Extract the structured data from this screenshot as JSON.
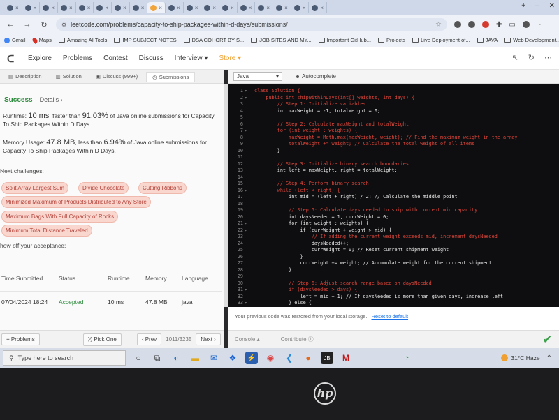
{
  "browser": {
    "url": "leetcode.com/problems/capacity-to-ship-packages-within-d-days/submissions/",
    "bookmarks": [
      {
        "label": "Gmail",
        "icon": "gmail-icon"
      },
      {
        "label": "Maps",
        "icon": "maps-pin-icon"
      },
      {
        "label": "Amazing AI Tools",
        "icon": "folder-icon"
      },
      {
        "label": "IMP SUBJECT NOTES",
        "icon": "folder-icon"
      },
      {
        "label": "DSA COHORT BY S...",
        "icon": "folder-icon"
      },
      {
        "label": "JOB SITES AND MY...",
        "icon": "folder-icon"
      },
      {
        "label": "Important GitHub...",
        "icon": "folder-icon"
      },
      {
        "label": "Projects",
        "icon": "folder-icon"
      },
      {
        "label": "Live Deployment of...",
        "icon": "folder-icon"
      },
      {
        "label": "JAVA",
        "icon": "folder-icon"
      },
      {
        "label": "Web Development...",
        "icon": "folder-icon"
      }
    ]
  },
  "nav": {
    "explore": "Explore",
    "problems": "Problems",
    "contest": "Contest",
    "discuss": "Discuss",
    "interview": "Interview",
    "store": "Store"
  },
  "subtabs": {
    "description": "Description",
    "solution": "Solution",
    "discuss": "Discuss (999+)",
    "submissions": "Submissions"
  },
  "result": {
    "status": "Success",
    "details": "Details",
    "runtime_prefix": "Runtime:",
    "runtime_value": "10 ms",
    "runtime_mid": ", faster than",
    "runtime_pct": "91.03%",
    "runtime_suffix": "of Java online submissions for Capacity To Ship Packages Within D Days.",
    "memory_prefix": "Memory Usage:",
    "memory_value": "47.8 MB",
    "memory_mid": ", less than",
    "memory_pct": "6.94%",
    "memory_suffix": "of Java online submissions for Capacity To Ship Packages Within D Days.",
    "next_label": "Next challenges:",
    "show_off": "how off your acceptance:"
  },
  "challenges": [
    "Split Array Largest Sum",
    "Divide Chocolate",
    "Cutting Ribbons",
    "Minimized Maximum of Products Distributed to Any Store",
    "Maximum Bags With Full Capacity of Rocks",
    "Minimum Total Distance Traveled"
  ],
  "table": {
    "headers": [
      "Time Submitted",
      "Status",
      "Runtime",
      "Memory",
      "Language"
    ],
    "row": [
      "07/04/2024 18:24",
      "Accepted",
      "10 ms",
      "47.8 MB",
      "java"
    ]
  },
  "leftbottom": {
    "problems": "Problems",
    "pick_one": "Pick One",
    "prev": "Prev",
    "pager": "1011/3235",
    "next": "Next"
  },
  "editor": {
    "language": "Java",
    "autocomplete": "Autocomplete",
    "restored_msg": "Your previous code was restored from your local storage.",
    "reset_link": "Reset to default",
    "console": "Console",
    "contribute": "Contribute"
  },
  "code_lines": [
    {
      "n": "1",
      "f": "▾",
      "t": "class Solution {",
      "c": "comment"
    },
    {
      "n": "2",
      "f": "▾",
      "t": "    public int shipWithinDays(int[] weights, int days) {",
      "c": "comment"
    },
    {
      "n": "3",
      "f": "",
      "t": "        // Step 1: Initialize variables",
      "c": "comment"
    },
    {
      "n": "4",
      "f": "",
      "t": "        int maxWeight = -1, totalWeight = 0;",
      "c": "kw"
    },
    {
      "n": "5",
      "f": "",
      "t": "",
      "c": "kw"
    },
    {
      "n": "6",
      "f": "",
      "t": "        // Step 2: Calculate maxWeight and totalWeight",
      "c": "comment"
    },
    {
      "n": "7",
      "f": "▾",
      "t": "        for (int weight : weights) {",
      "c": "comment"
    },
    {
      "n": "8",
      "f": "",
      "t": "            maxWeight = Math.max(maxWeight, weight); // Find the maximum weight in the array",
      "c": "comment"
    },
    {
      "n": "9",
      "f": "",
      "t": "            totalWeight += weight; // Calculate the total weight of all items",
      "c": "comment"
    },
    {
      "n": "10",
      "f": "",
      "t": "        }",
      "c": "kw"
    },
    {
      "n": "11",
      "f": "",
      "t": "",
      "c": "kw"
    },
    {
      "n": "12",
      "f": "",
      "t": "        // Step 3: Initialize binary search boundaries",
      "c": "comment"
    },
    {
      "n": "13",
      "f": "",
      "t": "        int left = maxWeight, right = totalWeight;",
      "c": "kw"
    },
    {
      "n": "14",
      "f": "",
      "t": "",
      "c": "kw"
    },
    {
      "n": "15",
      "f": "",
      "t": "        // Step 4: Perform binary search",
      "c": "comment"
    },
    {
      "n": "16",
      "f": "▾",
      "t": "        while (left < right) {",
      "c": "comment"
    },
    {
      "n": "17",
      "f": "",
      "t": "            int mid = (left + right) / 2; // Calculate the middle point",
      "c": "kw"
    },
    {
      "n": "18",
      "f": "",
      "t": "",
      "c": "kw"
    },
    {
      "n": "19",
      "f": "",
      "t": "            // Step 5: Calculate days needed to ship with current mid capacity",
      "c": "comment"
    },
    {
      "n": "20",
      "f": "",
      "t": "            int daysNeeded = 1, currWeight = 0;",
      "c": "kw"
    },
    {
      "n": "21",
      "f": "▾",
      "t": "            for (int weight : weights) {",
      "c": "kw"
    },
    {
      "n": "22",
      "f": "▾",
      "t": "                if (currWeight + weight > mid) {",
      "c": "kw"
    },
    {
      "n": "23",
      "f": "",
      "t": "                    // If adding the current weight exceeds mid, increment daysNeeded",
      "c": "comment"
    },
    {
      "n": "24",
      "f": "",
      "t": "                    daysNeeded++;",
      "c": "kw"
    },
    {
      "n": "25",
      "f": "",
      "t": "                    currWeight = 0; // Reset current shipment weight",
      "c": "kw"
    },
    {
      "n": "26",
      "f": "",
      "t": "                }",
      "c": "kw"
    },
    {
      "n": "27",
      "f": "",
      "t": "                currWeight += weight; // Accumulate weight for the current shipment",
      "c": "kw"
    },
    {
      "n": "28",
      "f": "",
      "t": "            }",
      "c": "kw"
    },
    {
      "n": "29",
      "f": "",
      "t": "",
      "c": "kw"
    },
    {
      "n": "30",
      "f": "",
      "t": "            // Step 6: Adjust search range based on daysNeeded",
      "c": "comment"
    },
    {
      "n": "31",
      "f": "▾",
      "t": "            if (daysNeeded > days) {",
      "c": "comment"
    },
    {
      "n": "32",
      "f": "",
      "t": "                left = mid + 1; // If daysNeeded is more than given days, increase left",
      "c": "kw"
    },
    {
      "n": "33",
      "f": "▾",
      "t": "            } else {",
      "c": "kw"
    }
  ],
  "taskbar": {
    "search_placeholder": "Type here to search",
    "weather": "31°C Haze"
  },
  "colors": {
    "success": "#2e8b3e",
    "chip_bg": "#f9d7cf",
    "chip_text": "#b4433a",
    "editor_bg": "#0e0e10",
    "code_comment": "#e0463a",
    "store": "#f0a030"
  }
}
